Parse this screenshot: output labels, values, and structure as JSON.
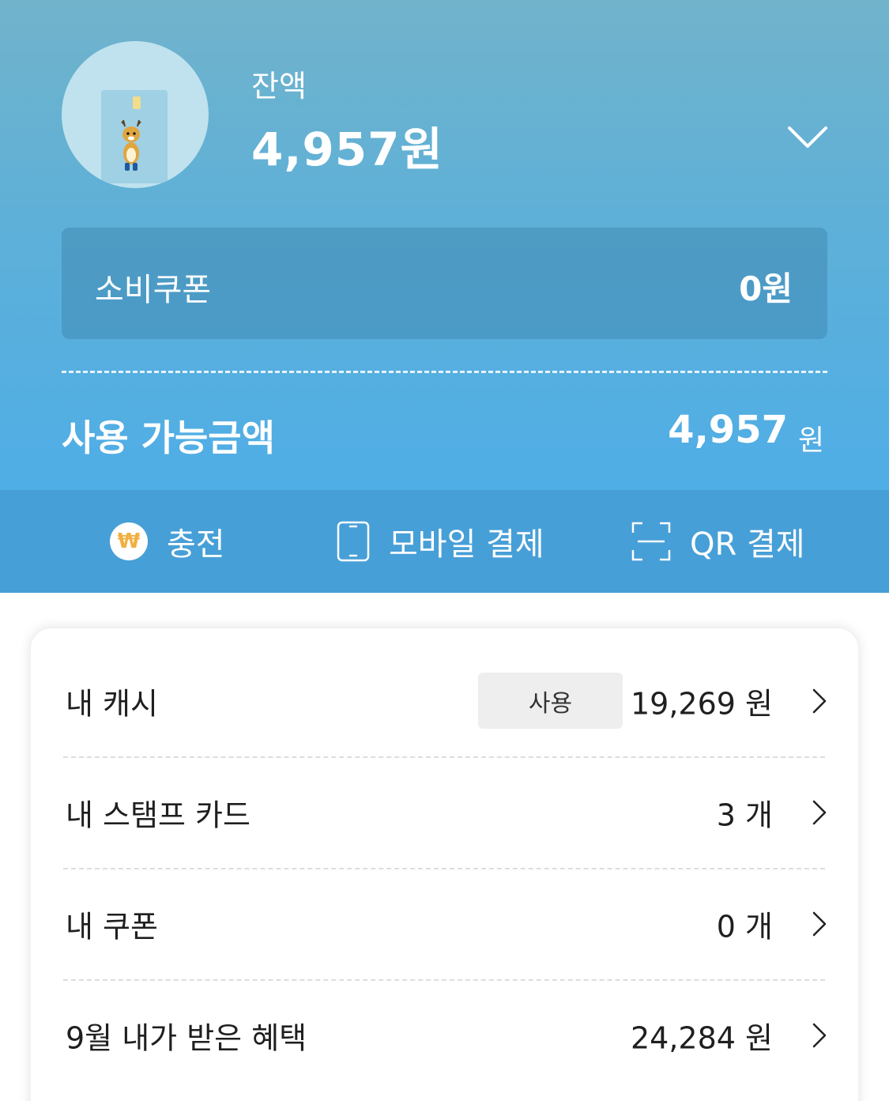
{
  "balance": {
    "label": "잔액",
    "value": "4,957원"
  },
  "coupon": {
    "label": "소비쿠폰",
    "value": "0원"
  },
  "available": {
    "label": "사용 가능금액",
    "amount": "4,957",
    "unit": "원"
  },
  "actions": [
    {
      "label": "충전",
      "icon": "won-icon"
    },
    {
      "label": "모바일 결제",
      "icon": "mobile-phone-icon"
    },
    {
      "label": "QR 결제",
      "icon": "qr-scan-icon"
    }
  ],
  "rows": [
    {
      "label": "내 캐시",
      "button": "사용",
      "value": "19,269 원"
    },
    {
      "label": "내 스탬프 카드",
      "value": "3 개"
    },
    {
      "label": "내 쿠폰",
      "value": "0 개"
    },
    {
      "label": "9월 내가 받은 혜택",
      "value": "24,284 원"
    }
  ],
  "icons": {
    "won": "₩"
  },
  "colors": {
    "header_top": "#71b3cb",
    "header_bottom": "#4faee6",
    "action_bar": "#479fd7",
    "won_icon": "#f0b040"
  }
}
